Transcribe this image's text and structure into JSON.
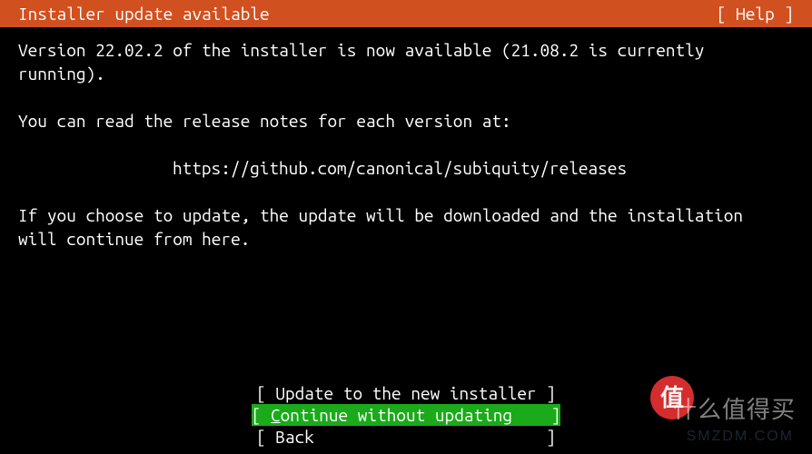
{
  "header": {
    "title": "Installer update available",
    "help_label": "[ Help ]"
  },
  "body": {
    "line1": "Version 22.02.2 of the installer is now available (21.08.2 is currently",
    "line2": "running).",
    "line3": "You can read the release notes for each version at:",
    "url": "https://github.com/canonical/subiquity/releases",
    "line4": "If you choose to update, the update will be downloaded and the installation",
    "line5": "will continue from here."
  },
  "buttons": {
    "update": {
      "open": "[ ",
      "text": "Update to the new installer",
      "close": " ]"
    },
    "continue": {
      "open": "[ ",
      "first_char": "C",
      "rest": "ontinue without updating   ",
      "close": " ]"
    },
    "back": {
      "open": "[ ",
      "text": "Back                       ",
      "close": " ]"
    }
  },
  "watermark": {
    "badge": "值",
    "cn": "什么值得买",
    "text": "SMZDM.COM"
  }
}
